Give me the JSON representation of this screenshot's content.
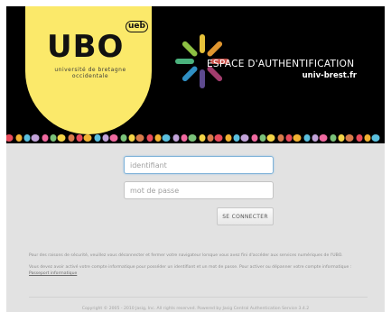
{
  "header": {
    "logo_text": "UBO",
    "logo_badge": "ueb",
    "logo_line1": "université de bretagne",
    "logo_line2": "occidentale",
    "title": "ESPACE D'AUTHENTIFICATION",
    "subtitle": "univ-brest.fr"
  },
  "form": {
    "username_placeholder": "identifiant",
    "password_placeholder": "mot de passe",
    "submit_label": "SE CONNECTER"
  },
  "notes": {
    "security": "Pour des raisons de sécurité, veuillez vous déconnecter et fermer votre navigateur lorsque vous avez fini d'accéder aux services numériques de l'UBO.",
    "activation_prefix": "Vous devez avoir activé votre compte informatique pour posséder un identifiant et un mot de passe. Pour activer ou dépanner votre compte informatique :",
    "activation_link": "Passeport informatique"
  },
  "footer": {
    "copyright": "Copyright © 2005 - 2010 Jasig, Inc. All rights reserved. Powered by Jasig Central Authentication Service 3.4.2"
  },
  "colors": {
    "header_bg": "#000000",
    "logo_yellow": "#fbe96a",
    "page_bg": "#e2e2e2",
    "spark_colors": [
      "#e6c23a",
      "#e0962f",
      "#c9514a",
      "#a23d6e",
      "#5d4a8e",
      "#2f8ec2",
      "#4bb27d",
      "#8dc043"
    ],
    "dot_colors": [
      "#e94b5c",
      "#f2b233",
      "#5bc0de",
      "#c2a3d9",
      "#f06aa0",
      "#7ac27a",
      "#f5d547",
      "#d97b4b"
    ]
  }
}
